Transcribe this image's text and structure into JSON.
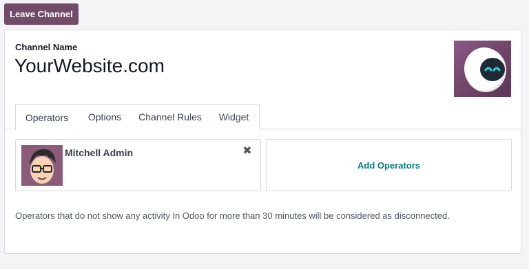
{
  "toolbar": {
    "leave_label": "Leave Channel"
  },
  "form": {
    "channel_name_label": "Channel Name",
    "channel_name_value": "YourWebsite.com"
  },
  "tabs": [
    {
      "label": "Operators",
      "active": true
    },
    {
      "label": "Options",
      "active": false
    },
    {
      "label": "Channel Rules",
      "active": false
    },
    {
      "label": "Widget",
      "active": false
    }
  ],
  "operators": {
    "items": [
      {
        "name": "Mitchell Admin",
        "remove_icon": "close-icon"
      }
    ],
    "add_label": "Add Operators",
    "hint": "Operators that do not show any activity In Odoo for more than 30 minutes will be considered as disconnected."
  },
  "colors": {
    "brand": "#714b67",
    "link": "#017e84",
    "border": "#d8dadd"
  }
}
